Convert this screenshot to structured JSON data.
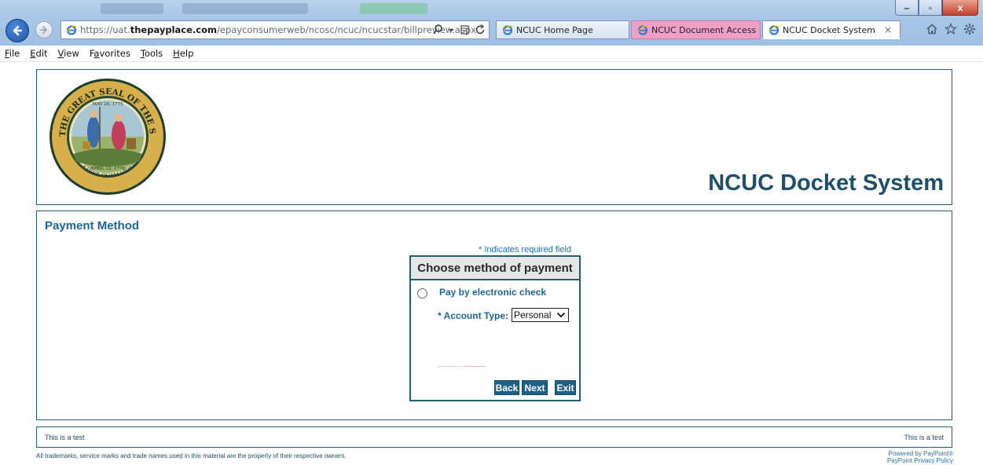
{
  "browser": {
    "address_url_prefix": "https://uat.",
    "address_url_domain": "thepayplace.com",
    "address_url_path": "/epayconsumerweb/ncosc/ncuc/ncucstar/billpreview.aspx",
    "tabs": [
      {
        "label": "NCUC Home Page",
        "state": "inactive"
      },
      {
        "label": "NCUC Document Access",
        "state": "highlighted"
      },
      {
        "label": "NCUC Docket System",
        "state": "active"
      }
    ],
    "tab_close": "×",
    "window_buttons": {
      "minimize": "–",
      "maximize": "▫",
      "close": "x"
    }
  },
  "menu": {
    "items": [
      {
        "label": "File",
        "underline": "F",
        "rest": "ile"
      },
      {
        "label": "Edit",
        "underline": "E",
        "rest": "dit"
      },
      {
        "label": "View",
        "underline": "V",
        "rest": "iew"
      },
      {
        "label": "Favorites",
        "underline": "a",
        "prefix": "F",
        "rest": "vorites"
      },
      {
        "label": "Tools",
        "underline": "T",
        "rest": "ools"
      },
      {
        "label": "Help",
        "underline": "H",
        "rest": "elp"
      }
    ]
  },
  "header": {
    "title": "NCUC Docket System",
    "seal": {
      "outer_text": "THE GREAT SEAL OF THE STATE OF NORTH CAROLINA",
      "date_top": "MAY 20, 1775",
      "date_bottom": "APRIL 12, 1776",
      "motto": "ESSE QUAM VIDERI"
    }
  },
  "payment": {
    "section_title": "Payment Method",
    "required_note": "* Indicates required field",
    "panel_title": "Choose method of payment",
    "option_label": "Pay by electronic check",
    "account_type_label": "* Account Type:",
    "account_type_value": "Personal",
    "buttons": {
      "back": "Back",
      "next": "Next",
      "exit": "Exit"
    }
  },
  "footer": {
    "left": "This is a test",
    "right": "This is a test",
    "trademark": "All trademarks, service marks and trade names used in this material are the property of their respective owners.",
    "powered": "Powered by PayPoint®",
    "privacy": "PayPoint Privacy Policy"
  },
  "colors": {
    "accent": "#1d6598",
    "border": "#1e5f7a",
    "button": "#1f6186",
    "highlight_tab": "#ef9fc6"
  },
  "icons": [
    "back-arrow-icon",
    "forward-arrow-icon",
    "ie-icon",
    "search-icon",
    "compat-view-icon",
    "refresh-icon",
    "home-icon",
    "favorites-star-icon",
    "settings-gear-icon",
    "chevron-down-icon",
    "radio-icon"
  ]
}
